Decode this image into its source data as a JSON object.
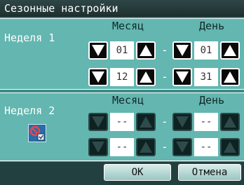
{
  "title": "Сезонные настройки",
  "labels": {
    "month": "Месяц",
    "day": "День",
    "separator": "-"
  },
  "weeks": [
    {
      "label": "Неделя 1",
      "rows": [
        {
          "month": "01",
          "day": "01"
        },
        {
          "month": "12",
          "day": "31"
        }
      ]
    },
    {
      "label": "Неделя 2",
      "rows": [
        {
          "month": "--",
          "day": "--"
        },
        {
          "month": "--",
          "day": "--"
        }
      ]
    }
  ],
  "buttons": {
    "ok": "OK",
    "cancel": "Отмена"
  },
  "colors": {
    "background": "#3c8d88",
    "panel": "#64b6b0",
    "titlebar": "#2f4646"
  }
}
